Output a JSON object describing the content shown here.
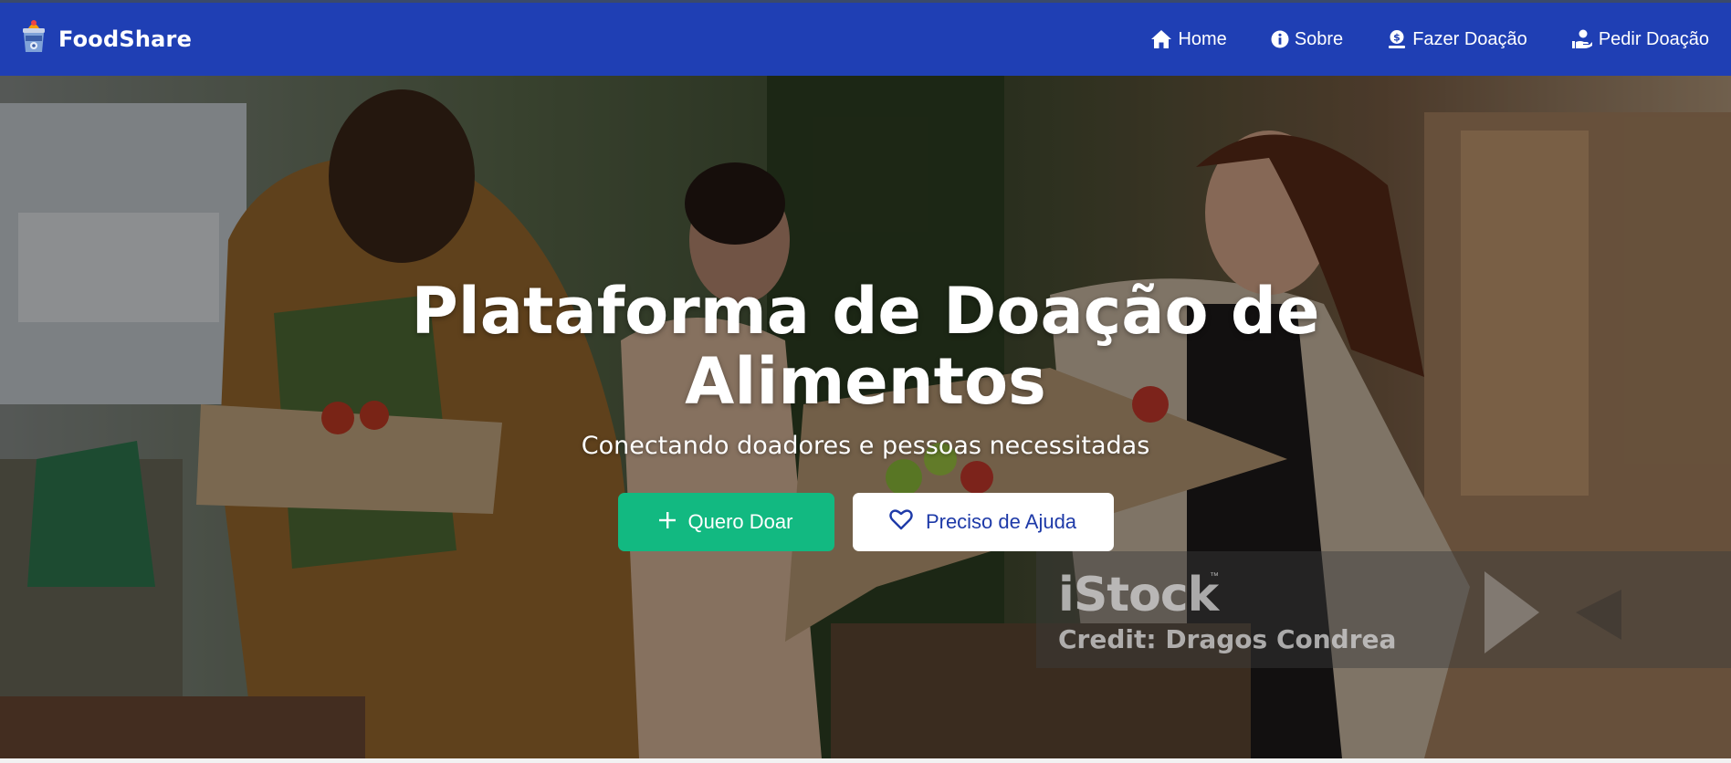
{
  "navbar": {
    "brand": "FoodShare",
    "brand_icon": "food-basket-icon",
    "links": [
      {
        "label": "Home",
        "icon": "home-icon"
      },
      {
        "label": "Sobre",
        "icon": "info-icon"
      },
      {
        "label": "Fazer Doação",
        "icon": "donate-coin-icon"
      },
      {
        "label": "Pedir Doação",
        "icon": "hand-receive-icon"
      }
    ],
    "background": "#1f3fb4"
  },
  "hero": {
    "title": "Plataforma de Doação de Alimentos",
    "subtitle": "Conectando doadores e pessoas necessitadas",
    "primary_button": {
      "label": "Quero Doar",
      "icon": "plus-icon",
      "color": "#12b981"
    },
    "secondary_button": {
      "label": "Preciso de Ajuda",
      "icon": "heart-icon",
      "color": "#1e3aa8"
    },
    "image_watermark": {
      "logo": "iStock",
      "credit": "Credit: Dragos Condrea"
    }
  }
}
